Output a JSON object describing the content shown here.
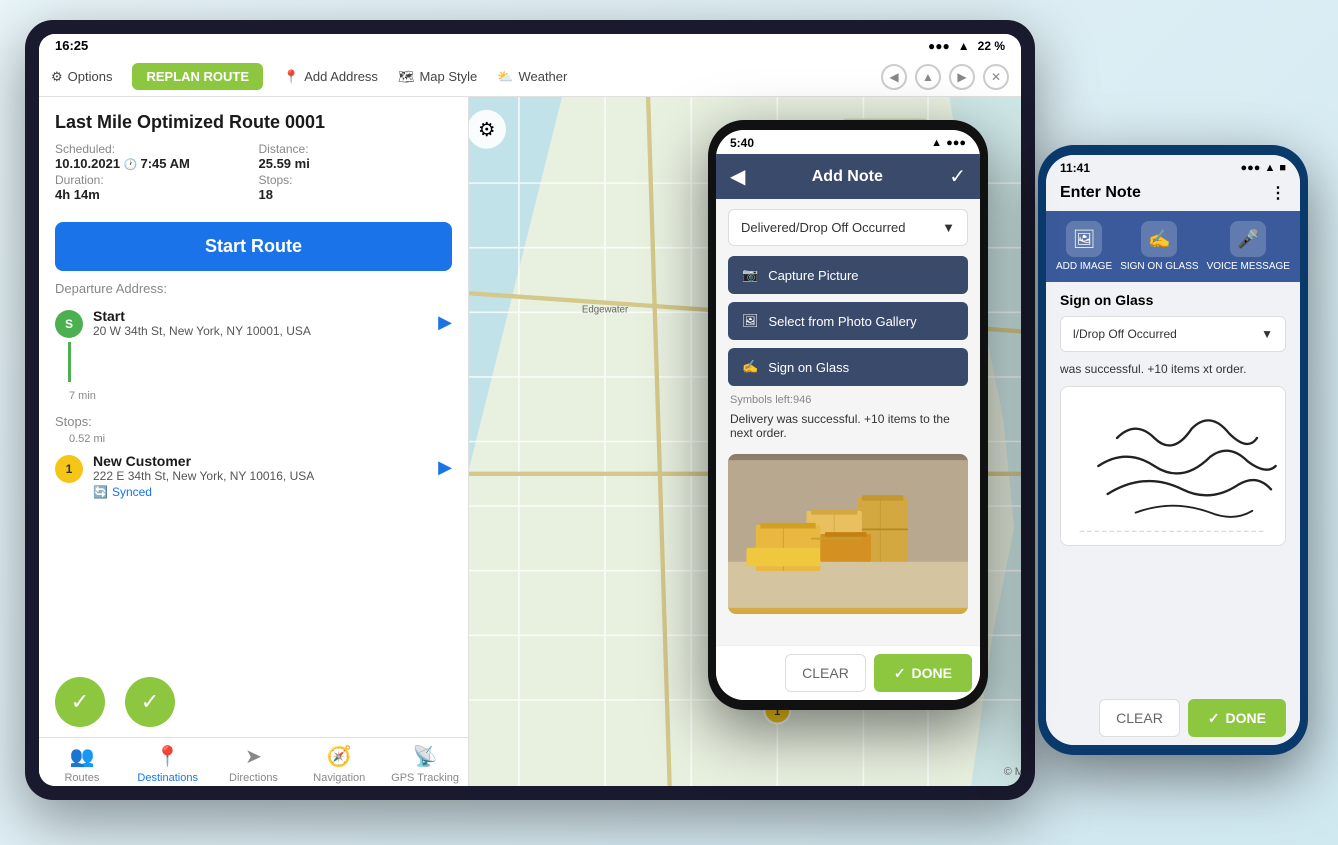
{
  "tablet": {
    "status_time": "16:25",
    "status_signal": "●●● ▲ 22%",
    "toolbar": {
      "options_label": "Options",
      "replan_label": "REPLAN ROUTE",
      "add_address_label": "Add Address",
      "map_style_label": "Map Style",
      "weather_label": "Weather"
    },
    "route": {
      "title": "Last Mile Optimized Route 0001",
      "scheduled_label": "Scheduled:",
      "scheduled_value": "10.10.2021",
      "scheduled_time": "7:45 AM",
      "distance_label": "Distance:",
      "distance_value": "25.59 mi",
      "duration_label": "Duration:",
      "duration_value": "4h 14m",
      "stops_label": "Stops:",
      "stops_value": "18",
      "start_route_btn": "Start Route"
    },
    "departure": {
      "label": "Departure Address:",
      "stop_name": "Start",
      "stop_address": "20 W 34th St, New York, NY 10001, USA",
      "time_dist": "7 min"
    },
    "stops_section": {
      "label": "Stops:",
      "dist": "0.52 mi",
      "stop1_name": "New Customer",
      "stop1_address": "222 E 34th St, New York, NY 10016, USA",
      "stop1_status": "Synced"
    },
    "tabs": [
      {
        "label": "Routes",
        "icon": "👥"
      },
      {
        "label": "Destinations",
        "icon": "📍",
        "active": true
      },
      {
        "label": "Directions",
        "icon": "➤"
      },
      {
        "label": "Navigation",
        "icon": "🧭"
      },
      {
        "label": "GPS Tracking",
        "icon": "📡"
      }
    ],
    "map_attribution": "© Maps"
  },
  "phone1": {
    "status_time": "5:40",
    "status_icons": "▲ ♥ ●●●",
    "header_title": "Add Note",
    "dropdown_value": "Delivered/Drop Off Occurred",
    "actions": [
      {
        "label": "Capture Picture",
        "icon": "📷"
      },
      {
        "label": "Select from Photo Gallery",
        "icon": "🖼"
      },
      {
        "label": "Sign on Glass",
        "icon": "✍"
      }
    ],
    "symbols_left": "Symbols left:946",
    "delivery_text": "Delivery was successful. +10 items to the next order.",
    "bottom_clear": "CLEAR",
    "bottom_done": "DONE"
  },
  "phone2": {
    "status_time": "11:41",
    "status_icons": "▲ 📶",
    "title": "Enter Note",
    "menu_icon": "⋮",
    "actions": [
      {
        "label": "ADD IMAGE",
        "icon": "🖼"
      },
      {
        "label": "SIGN ON GLASS",
        "icon": "✍"
      },
      {
        "label": "VOICE MESSAGE",
        "icon": "🎤"
      }
    ],
    "sign_on_glass_label": "Sign on Glass",
    "dropdown_value": "l/Drop Off Occurred",
    "delivery_text": "was successful. +10 items xt order.",
    "bottom_clear": "CLEAR",
    "bottom_done": "DONE"
  }
}
